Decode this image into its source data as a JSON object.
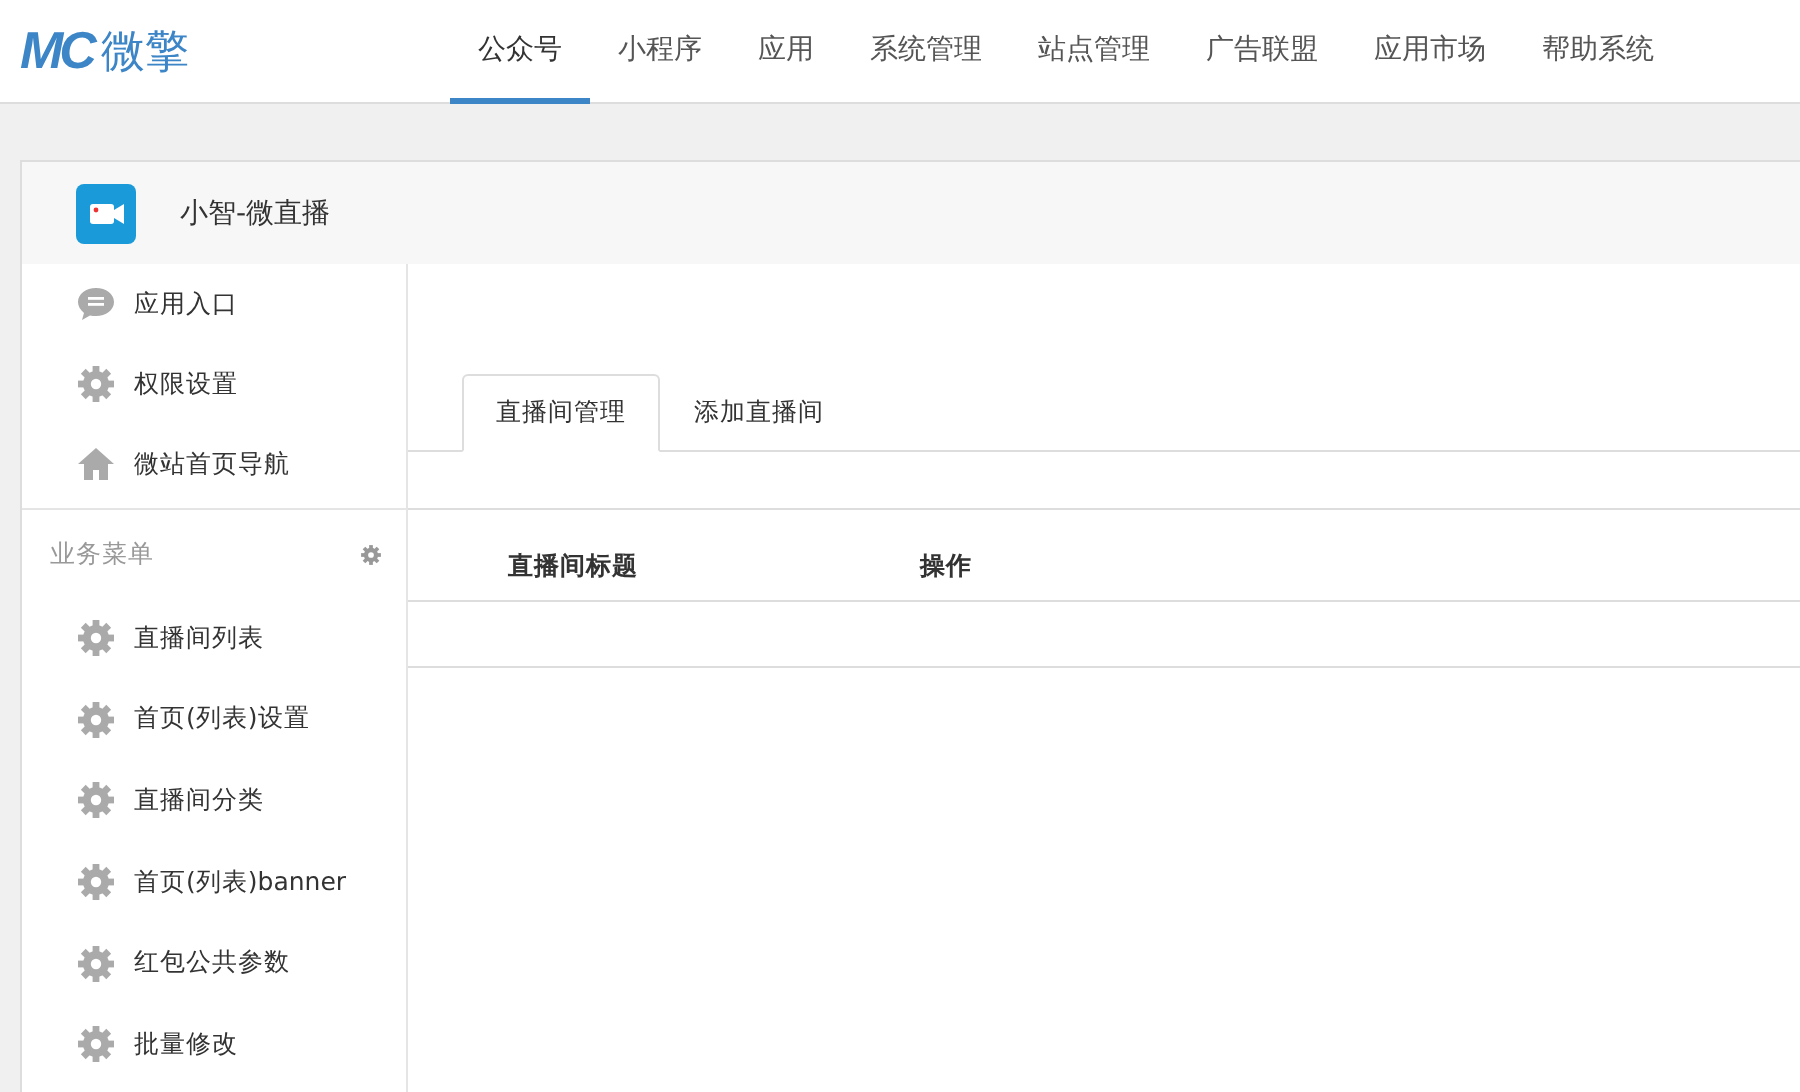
{
  "brand": {
    "mark": "MC",
    "name": "微擎"
  },
  "nav": [
    {
      "label": "公众号",
      "selected": true
    },
    {
      "label": "小程序",
      "selected": false
    },
    {
      "label": "应用",
      "selected": false
    },
    {
      "label": "系统管理",
      "selected": false
    },
    {
      "label": "站点管理",
      "selected": false
    },
    {
      "label": "广告联盟",
      "selected": false
    },
    {
      "label": "应用市场",
      "selected": false
    },
    {
      "label": "帮助系统",
      "selected": false
    }
  ],
  "app": {
    "title": "小智-微直播"
  },
  "sidebar": {
    "items": [
      {
        "label": "应用入口",
        "kind": "chat"
      },
      {
        "label": "权限设置",
        "kind": "gear"
      },
      {
        "label": "微站首页导航",
        "kind": "home"
      }
    ],
    "section": {
      "title": "业务菜单"
    },
    "menu": [
      {
        "label": "直播间列表",
        "kind": "gear"
      },
      {
        "label": "首页(列表)设置",
        "kind": "gear"
      },
      {
        "label": "直播间分类",
        "kind": "gear"
      },
      {
        "label": "首页(列表)banner",
        "kind": "gear"
      },
      {
        "label": "红包公共参数",
        "kind": "gear"
      },
      {
        "label": "批量修改",
        "kind": "gear"
      }
    ]
  },
  "tabs": [
    {
      "label": "直播间管理",
      "selected": true
    },
    {
      "label": "添加直播间",
      "selected": false
    }
  ],
  "table": {
    "columns": [
      "直播间标题",
      "操作"
    ]
  }
}
